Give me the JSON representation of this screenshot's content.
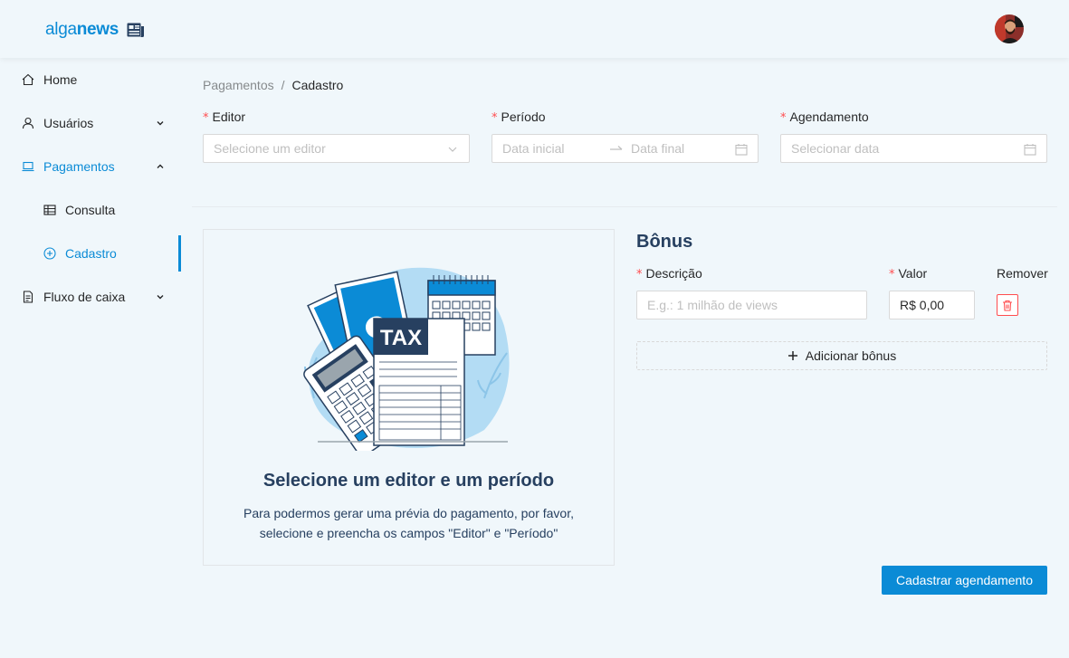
{
  "app": {
    "logo_text_light": "alga",
    "logo_text_bold": "news",
    "brand_color": "#0b8bd6"
  },
  "sidebar": {
    "items": [
      {
        "label": "Home",
        "icon": "home-icon"
      },
      {
        "label": "Usuários",
        "icon": "user-icon",
        "expandable": true
      },
      {
        "label": "Pagamentos",
        "icon": "laptop-icon",
        "expandable": true,
        "expanded": true
      },
      {
        "label": "Consulta",
        "icon": "table-icon"
      },
      {
        "label": "Cadastro",
        "icon": "plus-circle-icon",
        "selected": true
      },
      {
        "label": "Fluxo de caixa",
        "icon": "file-icon",
        "expandable": true
      }
    ]
  },
  "breadcrumb": {
    "items": [
      "Pagamentos",
      "Cadastro"
    ],
    "separator": "/"
  },
  "form": {
    "editor": {
      "label": "Editor",
      "placeholder": "Selecione um editor"
    },
    "period": {
      "label": "Período",
      "start_placeholder": "Data inicial",
      "end_placeholder": "Data final"
    },
    "schedule": {
      "label": "Agendamento",
      "placeholder": "Selecionar data"
    },
    "required_mark": "*"
  },
  "preview": {
    "illustration_text": "TAX",
    "title": "Selecione um editor e um período",
    "description": "Para podermos gerar uma prévia do pagamento, por favor, selecione e preencha os campos \"Editor\" e \"Período\""
  },
  "bonus": {
    "title": "Bônus",
    "description_label": "Descrição",
    "description_placeholder": "E.g.: 1 milhão de views",
    "value_label": "Valor",
    "value": "R$ 0,00",
    "remove_label": "Remover",
    "add_label": "Adicionar bônus"
  },
  "submit_label": "Cadastrar agendamento"
}
